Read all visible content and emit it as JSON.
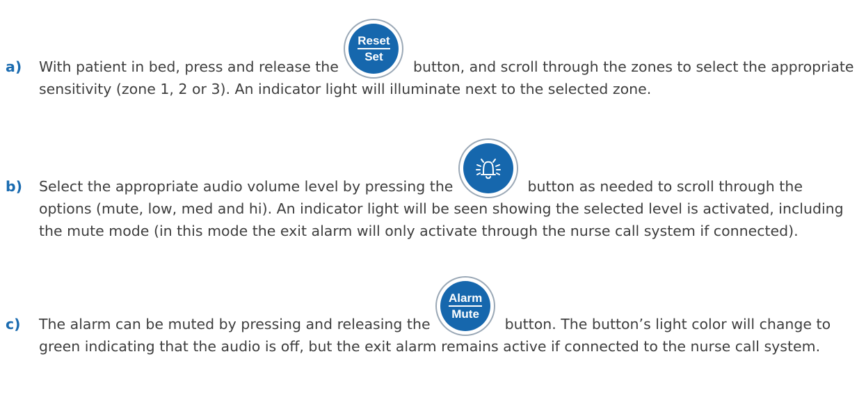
{
  "steps": [
    {
      "marker": "a)",
      "text_before": "With patient in bed, press and release the",
      "text_after": "button, and scroll through the zones to select the appropriate sensitivity (zone 1, 2 or 3). An indicator light will illuminate next to the selected zone.",
      "button": {
        "top_label": "Reset",
        "bottom_label": "Set",
        "icon": "reset-set-icon"
      }
    },
    {
      "marker": "b)",
      "text_before": "Select the appropriate audio volume level by pressing the",
      "text_after": "button as needed to scroll through the options (mute, low, med and hi). An indicator light will be seen showing the selected level is activated, including the mute mode (in this mode the exit alarm will only activate through the nurse call system if connected).",
      "button": {
        "icon": "bell-icon"
      }
    },
    {
      "marker": "c)",
      "text_before": "The alarm can be muted by pressing and releasing the",
      "text_after": "button. The button’s light color will change to green indicating that the audio is off, but the exit alarm remains active if connected to the nurse call system.",
      "button": {
        "top_label": "Alarm",
        "bottom_label": "Mute",
        "icon": "alarm-mute-icon"
      }
    }
  ],
  "colors": {
    "button_blue": "#1667ad",
    "marker_blue": "#1a6bb0",
    "body_text": "#3d3d3d",
    "button_ring": "#9aa8b6"
  }
}
